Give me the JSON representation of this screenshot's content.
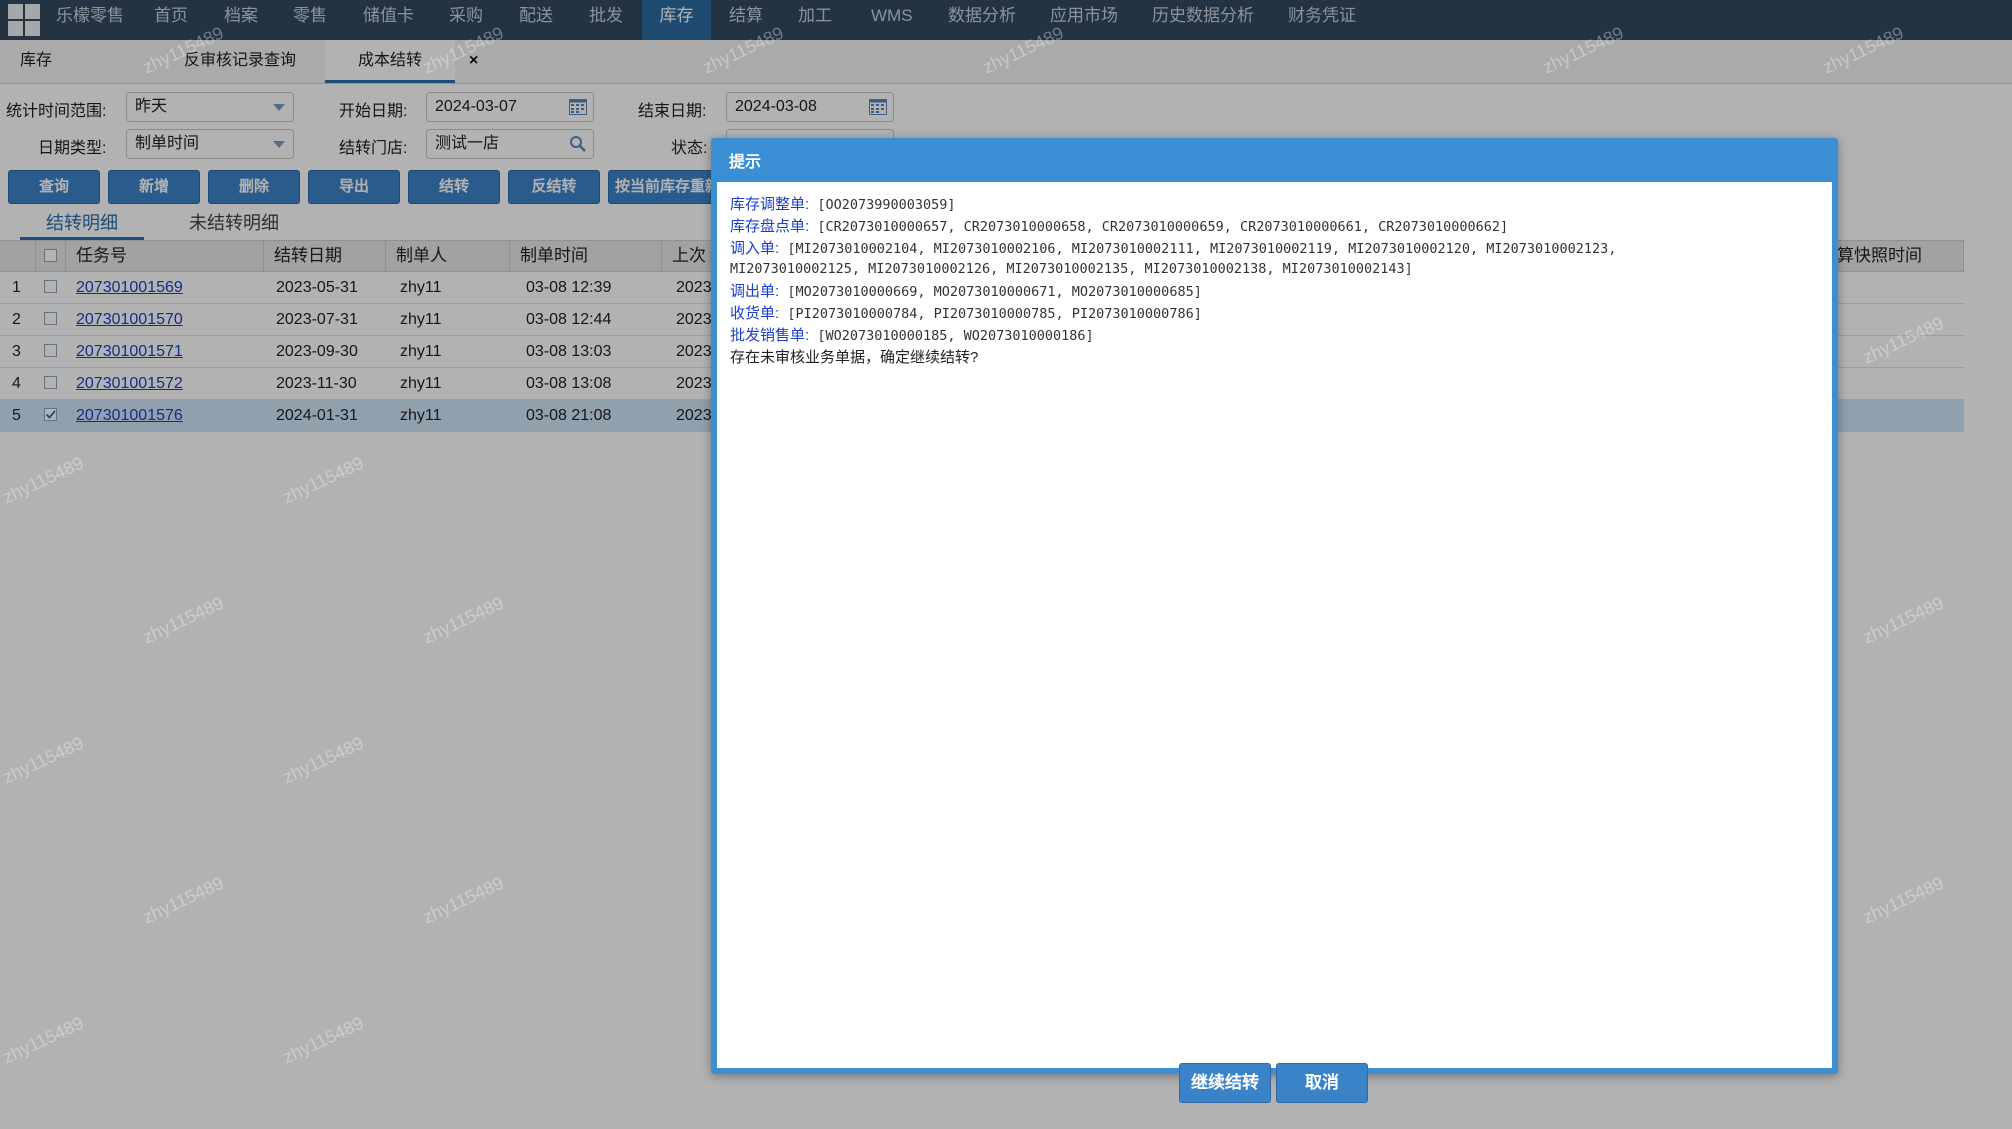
{
  "topnav": {
    "brand": "乐檬零售",
    "items": [
      "首页",
      "档案",
      "零售",
      "储值卡",
      "采购",
      "配送",
      "批发",
      "库存",
      "结算",
      "加工",
      "WMS",
      "数据分析",
      "应用市场",
      "历史数据分析",
      "财务凭证"
    ],
    "active": "库存"
  },
  "tabs": {
    "items": [
      "库存",
      "反审核记录查询",
      "成本结转"
    ],
    "active": "成本结转",
    "close_symbol": "×"
  },
  "filters": {
    "stat_range_label": "统计时间范围:",
    "stat_range_value": "昨天",
    "start_date_label": "开始日期:",
    "start_date_value": "2024-03-07",
    "end_date_label": "结束日期:",
    "end_date_value": "2024-03-08",
    "date_type_label": "日期类型:",
    "date_type_value": "制单时间",
    "store_label": "结转门店:",
    "store_value": "测试一店",
    "status_label": "状态:"
  },
  "toolbar": {
    "buttons": [
      "查询",
      "新增",
      "删除",
      "导出",
      "结转",
      "反结转",
      "按当前库存重新"
    ]
  },
  "subtabs": [
    "结转明细",
    "未结转明细"
  ],
  "grid": {
    "columns": [
      "任务号",
      "结转日期",
      "制单人",
      "制单时间",
      "上次",
      "算快照时间"
    ],
    "rows": [
      {
        "no": "1",
        "task": "207301001569",
        "date": "2023-05-31",
        "maker": "zhy11",
        "time": "03-08 12:39",
        "prev": "2023",
        "checked": false
      },
      {
        "no": "2",
        "task": "207301001570",
        "date": "2023-07-31",
        "maker": "zhy11",
        "time": "03-08 12:44",
        "prev": "2023",
        "checked": false
      },
      {
        "no": "3",
        "task": "207301001571",
        "date": "2023-09-30",
        "maker": "zhy11",
        "time": "03-08 13:03",
        "prev": "2023",
        "checked": false
      },
      {
        "no": "4",
        "task": "207301001572",
        "date": "2023-11-30",
        "maker": "zhy11",
        "time": "03-08 13:08",
        "prev": "2023",
        "checked": false
      },
      {
        "no": "5",
        "task": "207301001576",
        "date": "2024-01-31",
        "maker": "zhy11",
        "time": "03-08 21:08",
        "prev": "2023",
        "checked": true
      }
    ]
  },
  "watermark": "zhy115489",
  "dialog": {
    "title": "提示",
    "lines": [
      {
        "key": "库存调整单:",
        "value": "[OO2073990003059]"
      },
      {
        "key": "库存盘点单:",
        "value": "[CR2073010000657, CR2073010000658, CR2073010000659, CR2073010000661, CR2073010000662]"
      },
      {
        "key": "调入单:",
        "value": "[MI2073010002104, MI2073010002106, MI2073010002111, MI2073010002119, MI2073010002120, MI2073010002123,"
      },
      {
        "key": "",
        "value": "MI2073010002125, MI2073010002126, MI2073010002135, MI2073010002138, MI2073010002143]"
      },
      {
        "key": "调出单:",
        "value": "[MO2073010000669, MO2073010000671, MO2073010000685]"
      },
      {
        "key": "收货单:",
        "value": "[PI2073010000784, PI2073010000785, PI2073010000786]"
      },
      {
        "key": "批发销售单:",
        "value": "[WO2073010000185, WO2073010000186]"
      }
    ],
    "message": "存在未审核业务单据，确定继续结转?",
    "confirm_label": "继续结转",
    "cancel_label": "取消"
  }
}
